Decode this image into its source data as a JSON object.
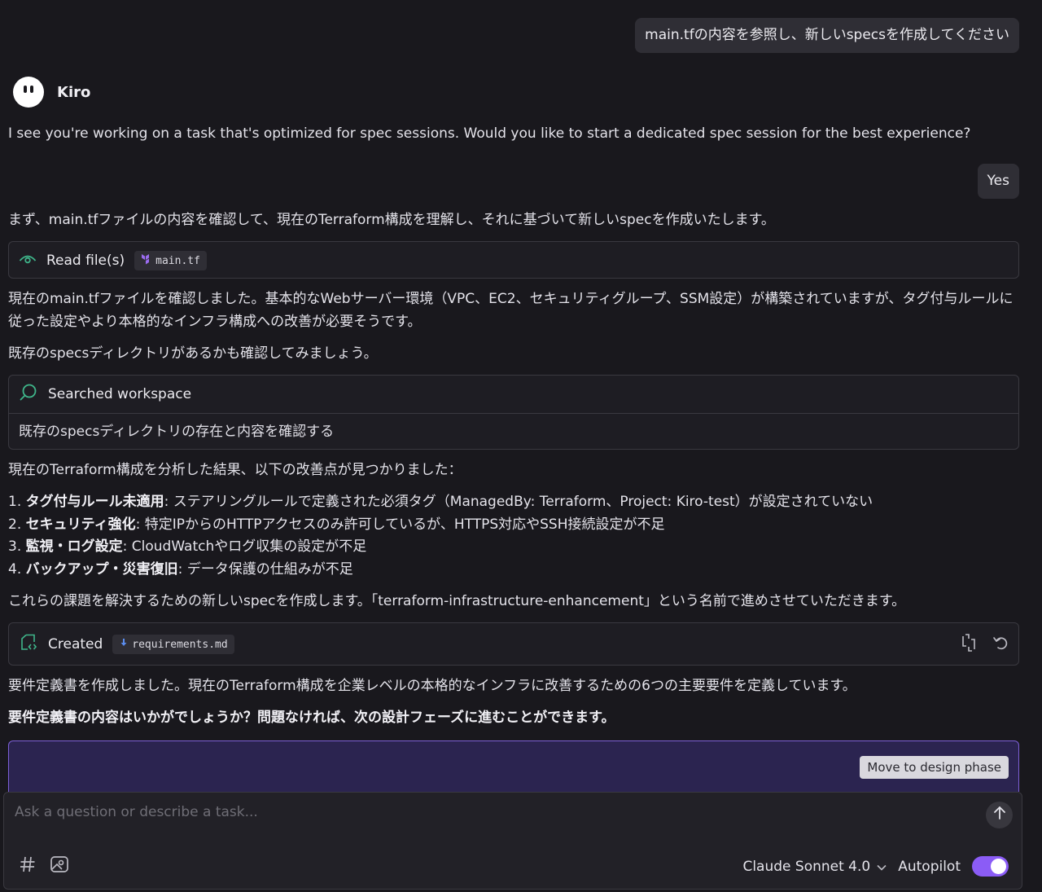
{
  "user_messages": [
    "main.tfの内容を参照し、新しいspecsを作成してください",
    "Yes"
  ],
  "agent": {
    "name": "Kiro"
  },
  "messages": {
    "intro": "I see you're working on a task that's optimized for spec sessions. Would you like to start a dedicated spec session for the best experience?",
    "p1": "まず、main.tfファイルの内容を確認して、現在のTerraform構成を理解し、それに基づいて新しいspecを作成いたします。",
    "p2": "現在のmain.tfファイルを確認しました。基本的なWebサーバー環境（VPC、EC2、セキュリティグループ、SSM設定）が構築されていますが、タグ付与ルールに従った設定やより本格的なインフラ構成への改善が必要そうです。",
    "p3": "既存のspecsディレクトリがあるかも確認してみましょう。",
    "p4": "現在のTerraform構成を分析した結果、以下の改善点が見つかりました：",
    "p5": "これらの課題を解決するための新しいspecを作成します。「terraform-infrastructure-enhancement」という名前で進めさせていただきます。",
    "p6": "要件定義書を作成しました。現在のTerraform構成を企業レベルの本格的なインフラに改善するための6つの主要要件を定義しています。",
    "p7": "要件定義書の内容はいかがでしょうか？問題なければ、次の設計フェーズに進むことができます。"
  },
  "issues": [
    {
      "num": "1.",
      "title": "タグ付与ルール未適用",
      "desc": ": ステアリングルールで定義された必須タグ（ManagedBy: Terraform、Project: Kiro-test）が設定されていない"
    },
    {
      "num": "2.",
      "title": "セキュリティ強化",
      "desc": ": 特定IPからのHTTPアクセスのみ許可しているが、HTTPS対応やSSH接続設定が不足"
    },
    {
      "num": "3.",
      "title": "監視・ログ設定",
      "desc": ": CloudWatchやログ収集の設定が不足"
    },
    {
      "num": "4.",
      "title": "バックアップ・災害復旧",
      "desc": ": データ保護の仕組みが不足"
    }
  ],
  "cards": {
    "read": {
      "label": "Read file(s)",
      "file": "main.tf",
      "icon": "eye-icon"
    },
    "search": {
      "label": "Searched workspace",
      "detail": "既存のspecsディレクトリの存在と内容を確認する",
      "icon": "search-icon"
    },
    "created": {
      "label": "Created",
      "file": "requirements.md",
      "icon": "file-code-icon"
    }
  },
  "phase": {
    "button": "Move to design phase"
  },
  "composer": {
    "placeholder": "Ask a question or describe a task...",
    "model": "Claude Sonnet 4.0",
    "autopilot": "Autopilot",
    "autopilot_on": true
  },
  "colors": {
    "background": "#19181d",
    "accent": "#8b5cf6",
    "terraform": "#9b6cf0",
    "success": "#3fb58a"
  }
}
